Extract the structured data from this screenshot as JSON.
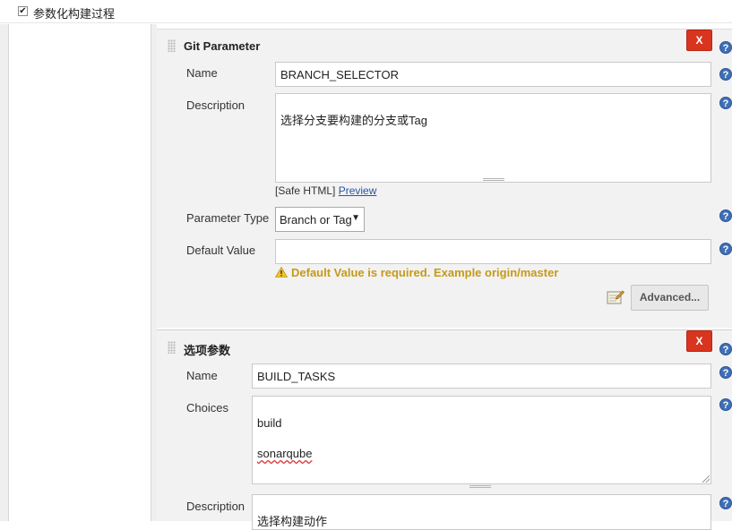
{
  "section": {
    "checkbox_mark": "✔",
    "label": "参数化构建过程"
  },
  "git_parameter": {
    "title": "Git Parameter",
    "delete_label": "X",
    "name_label": "Name",
    "name_value": "BRANCH_SELECTOR",
    "description_label": "Description",
    "description_value": "选择分支要构建的分支或Tag",
    "safe_html_text": "[Safe HTML]",
    "preview_link": "Preview",
    "parameter_type_label": "Parameter Type",
    "parameter_type_value": "Branch or Tag",
    "default_value_label": "Default Value",
    "default_value_value": "",
    "warning_text": "Default Value is required. Example origin/master",
    "advanced_label": "Advanced..."
  },
  "choice_parameter": {
    "title": "选项参数",
    "delete_label": "X",
    "name_label": "Name",
    "name_value": "BUILD_TASKS",
    "choices_label": "Choices",
    "choices": [
      "build",
      "sonarqube"
    ],
    "description_label": "Description",
    "description_value": "选择构建动作"
  },
  "help_glyph": "?",
  "icons": {
    "delete": "close-icon",
    "help": "help-icon",
    "warning": "warning-icon",
    "edit": "notepad-edit-icon",
    "drag": "drag-handle-icon"
  },
  "colors": {
    "delete_button": "#d9341f",
    "help_icon": "#3f6fb6",
    "warning_text": "#c59a17",
    "link": "#2a55a5",
    "panel_bg": "#f2f2f2"
  }
}
